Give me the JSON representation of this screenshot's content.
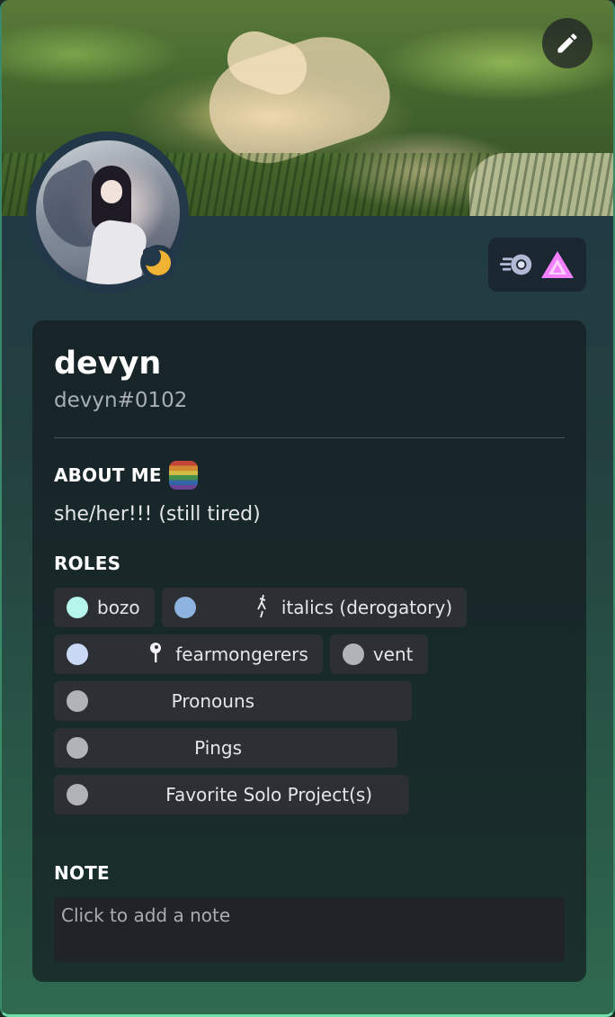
{
  "banner": {
    "edit_icon": "pencil-icon"
  },
  "avatar": {
    "status": "idle",
    "status_icon": "moon-icon",
    "status_color": "#f0b232"
  },
  "badges": [
    {
      "icon": "nitro-badge-icon",
      "color": "#b3b8d4"
    },
    {
      "icon": "hypesquad-brilliance-badge-icon",
      "color": "#f47fff"
    }
  ],
  "profile": {
    "username": "devyn",
    "tag": "devyn#0102"
  },
  "about": {
    "title": "ABOUT ME",
    "emoji": "pride-flag-emoji",
    "text": "she/her!!! (still tired)"
  },
  "roles": {
    "title": "ROLES",
    "items": [
      {
        "label": "bozo",
        "color": "#b5f5ec",
        "emoji": ""
      },
      {
        "label": "italics (derogatory)",
        "color": "#8fb3e0",
        "emoji": "stick-figure-emoji"
      },
      {
        "label": "fearmongerers",
        "color": "#c9d9f5",
        "emoji": "pin-emoji"
      },
      {
        "label": "vent",
        "color": "#b0b3b8",
        "emoji": ""
      },
      {
        "label": "             Pronouns             ",
        "color": "#b0b3b8",
        "emoji": ""
      },
      {
        "label": "                 Pings                 ",
        "color": "#b0b3b8",
        "emoji": ""
      },
      {
        "label": "            Favorite Solo Project(s)",
        "color": "#b0b3b8",
        "emoji": ""
      }
    ]
  },
  "note": {
    "title": "NOTE",
    "placeholder": "Click to add a note"
  }
}
